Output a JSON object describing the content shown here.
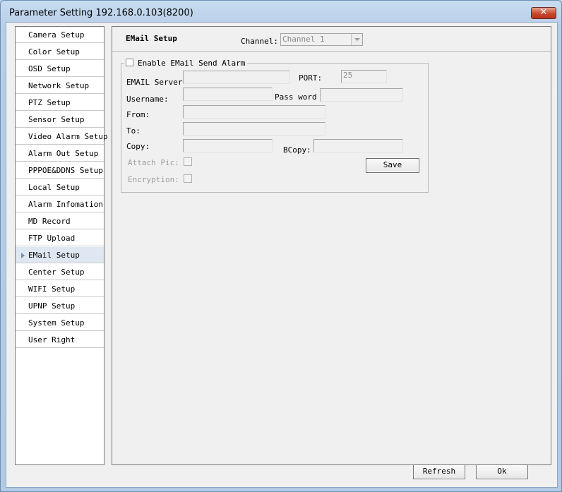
{
  "window": {
    "title": "Parameter Setting 192.168.0.103(8200)",
    "close_label": "✕"
  },
  "sidebar": {
    "items": [
      {
        "label": "Camera Setup"
      },
      {
        "label": "Color Setup"
      },
      {
        "label": "OSD Setup"
      },
      {
        "label": "Network Setup"
      },
      {
        "label": "PTZ Setup"
      },
      {
        "label": "Sensor Setup"
      },
      {
        "label": "Video Alarm Setup"
      },
      {
        "label": "Alarm Out Setup"
      },
      {
        "label": "PPPOE&DDNS Setup"
      },
      {
        "label": "Local Setup"
      },
      {
        "label": "Alarm Infomation"
      },
      {
        "label": "MD Record"
      },
      {
        "label": "FTP Upload"
      },
      {
        "label": "EMail Setup"
      },
      {
        "label": "Center Setup"
      },
      {
        "label": "WIFI Setup"
      },
      {
        "label": "UPNP Setup"
      },
      {
        "label": "System Setup"
      },
      {
        "label": "User Right"
      }
    ],
    "active_index": 13
  },
  "header": {
    "title": "EMail Setup",
    "channel_label": "Channel:",
    "channel_value": "Channel 1"
  },
  "form": {
    "enable_label": "Enable EMail Send Alarm",
    "enable_checked": false,
    "server_label": "EMAIL Server",
    "server_value": "",
    "port_label": "PORT:",
    "port_value": "25",
    "username_label": "Username:",
    "username_value": "",
    "password_label": "Pass word",
    "password_value": "",
    "from_label": "From:",
    "from_value": "",
    "to_label": "To:",
    "to_value": "",
    "copy_label": "Copy:",
    "copy_value": "",
    "bcopy_label": "BCopy:",
    "bcopy_value": "",
    "attach_label": "Attach Pic:",
    "encryption_label": "Encryption:",
    "save_label": "Save"
  },
  "footer": {
    "refresh_label": "Refresh",
    "ok_label": "Ok"
  },
  "colors": {
    "title_gradient": "#bcd3ea",
    "close_red": "#c9462e",
    "active_item": "#dfe8f2"
  }
}
